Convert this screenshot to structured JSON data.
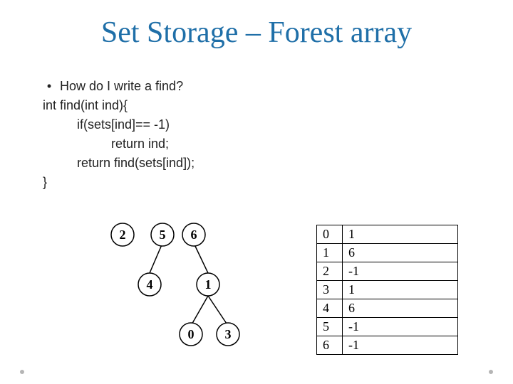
{
  "title": "Set Storage – Forest array",
  "bullet": "How do I write a find?",
  "code": {
    "l0": "int find(int ind){",
    "l1": "if(sets[ind]== -1)",
    "l2": "return ind;",
    "l3": "return find(sets[ind]);",
    "l4": "}"
  },
  "tree": {
    "nodes": {
      "n2": "2",
      "n5": "5",
      "n6": "6",
      "n4": "4",
      "n1": "1",
      "n0": "0",
      "n3": "3"
    }
  },
  "table": {
    "rows": [
      {
        "idx": "0",
        "val": "1"
      },
      {
        "idx": "1",
        "val": "6"
      },
      {
        "idx": "2",
        "val": "-1"
      },
      {
        "idx": "3",
        "val": "1"
      },
      {
        "idx": "4",
        "val": "6"
      },
      {
        "idx": "5",
        "val": "-1"
      },
      {
        "idx": "6",
        "val": "-1"
      }
    ]
  }
}
